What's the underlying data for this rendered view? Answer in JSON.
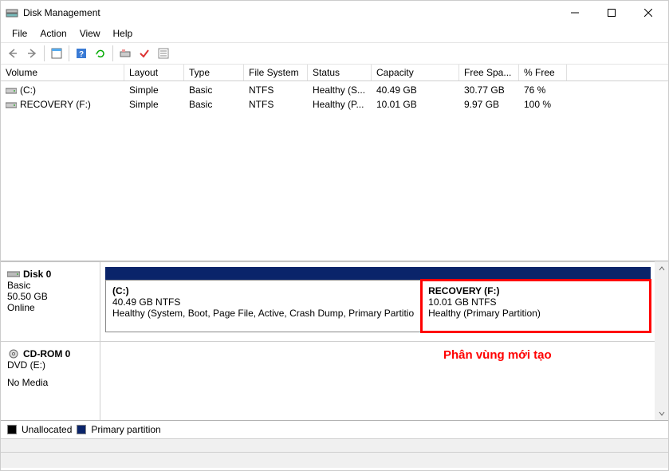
{
  "window": {
    "title": "Disk Management"
  },
  "menubar": [
    "File",
    "Action",
    "View",
    "Help"
  ],
  "volume_table": {
    "headers": [
      "Volume",
      "Layout",
      "Type",
      "File System",
      "Status",
      "Capacity",
      "Free Spa...",
      "% Free"
    ],
    "rows": [
      {
        "volume": "(C:)",
        "layout": "Simple",
        "type": "Basic",
        "fs": "NTFS",
        "status": "Healthy (S...",
        "capacity": "40.49 GB",
        "free": "30.77 GB",
        "pct": "76 %"
      },
      {
        "volume": "RECOVERY (F:)",
        "layout": "Simple",
        "type": "Basic",
        "fs": "NTFS",
        "status": "Healthy (P...",
        "capacity": "10.01 GB",
        "free": "9.97 GB",
        "pct": "100 %"
      }
    ]
  },
  "disks": {
    "disk0": {
      "name": "Disk 0",
      "type": "Basic",
      "size": "50.50 GB",
      "status": "Online",
      "partitions": [
        {
          "name": "(C:)",
          "size": "40.49 GB NTFS",
          "status_long": "Healthy (System, Boot, Page File, Active, Crash Dump, Primary Partitio"
        },
        {
          "name": "RECOVERY  (F:)",
          "size": "10.01 GB NTFS",
          "status_long": "Healthy (Primary Partition)"
        }
      ]
    },
    "cdrom0": {
      "name": "CD-ROM 0",
      "type": "DVD (E:)",
      "status": "No Media"
    }
  },
  "legend": {
    "unallocated": "Unallocated",
    "primary": "Primary partition"
  },
  "annotation": "Phân vùng mới tạo",
  "colors": {
    "stripe": "#0a246a",
    "highlight": "#ff0000",
    "unallocated_sw": "#000000"
  }
}
